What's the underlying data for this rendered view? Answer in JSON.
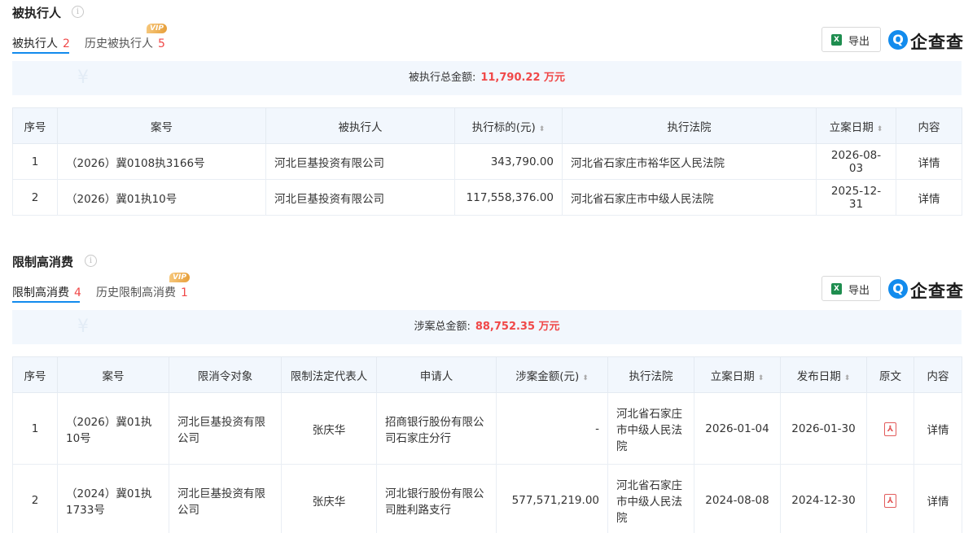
{
  "section1": {
    "title": "被执行人",
    "tabs": [
      {
        "label": "被执行人",
        "count": "2"
      },
      {
        "label": "历史被执行人",
        "count": "5"
      }
    ],
    "vip_badge": "VIP",
    "export_label": "导出",
    "logo_text": "企查查",
    "summary_label": "被执行总金额:",
    "summary_amount": "11,790.22 万元",
    "columns": [
      "序号",
      "案号",
      "被执行人",
      "执行标的(元)",
      "执行法院",
      "立案日期",
      "内容"
    ],
    "rows": [
      {
        "no": "1",
        "case": "（2026）冀0108执3166号",
        "party": "河北巨基投资有限公司",
        "amount": "343,790.00",
        "court": "河北省石家庄市裕华区人民法院",
        "date": "2026-08-03",
        "action": "详情"
      },
      {
        "no": "2",
        "case": "（2026）冀01执10号",
        "party": "河北巨基投资有限公司",
        "amount": "117,558,376.00",
        "court": "河北省石家庄市中级人民法院",
        "date": "2025-12-31",
        "action": "详情"
      }
    ]
  },
  "section2": {
    "title": "限制高消费",
    "tabs": [
      {
        "label": "限制高消费",
        "count": "4"
      },
      {
        "label": "历史限制高消费",
        "count": "1"
      }
    ],
    "vip_badge": "VIP",
    "export_label": "导出",
    "logo_text": "企查查",
    "summary_label": "涉案总金额:",
    "summary_amount": "88,752.35 万元",
    "columns": [
      "序号",
      "案号",
      "限消令对象",
      "限制法定代表人",
      "申请人",
      "涉案金额(元)",
      "执行法院",
      "立案日期",
      "发布日期",
      "原文",
      "内容"
    ],
    "rows": [
      {
        "no": "1",
        "case": "（2026）冀01执10号",
        "target": "河北巨基投资有限公司",
        "rep": "张庆华",
        "applicant": "招商银行股份有限公司石家庄分行",
        "amount": "-",
        "court": "河北省石家庄市中级人民法院",
        "file_date": "2026-01-04",
        "pub_date": "2026-01-30",
        "action": "详情"
      },
      {
        "no": "2",
        "case": "（2024）冀01执1733号",
        "target": "河北巨基投资有限公司",
        "rep": "张庆华",
        "applicant": "河北银行股份有限公司胜利路支行",
        "amount": "577,571,219.00",
        "court": "河北省石家庄市中级人民法院",
        "file_date": "2024-08-08",
        "pub_date": "2024-12-30",
        "action": "详情"
      }
    ]
  },
  "icons": {
    "info": "info-icon",
    "excel": "excel-icon",
    "pdf": "pdf-icon",
    "sort": "sort-icon",
    "logo": "qcc-logo-icon"
  },
  "colors": {
    "accent": "#128bed",
    "count_red": "#f04848",
    "header_bg": "#f2f7fd"
  }
}
